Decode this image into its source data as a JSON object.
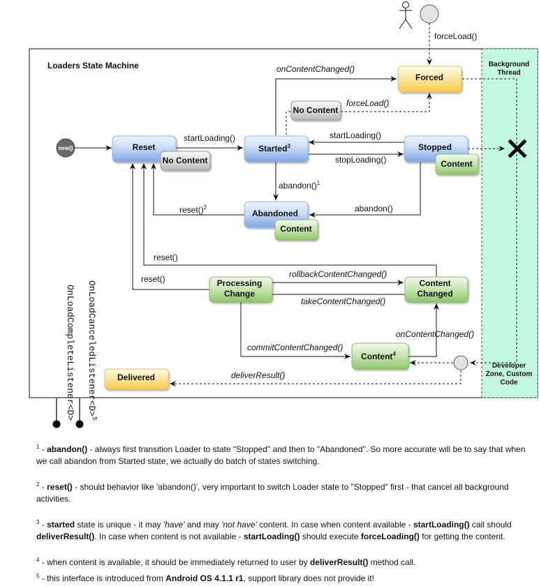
{
  "diagram": {
    "title": "Loaders State Machine",
    "zones": {
      "background_thread": "Background Thread",
      "background_thread_lines": [
        "Background",
        "Thread"
      ],
      "developer_zone_lines": [
        "Developer",
        "Zone, Custom",
        "Code"
      ]
    },
    "colors": {
      "blue_state": "#8fb4e8",
      "green_state": "#a9d48a",
      "yellow_state": "#fbd66a",
      "gray_state": "#cfcfcf",
      "zone_fill": "#c4f7e1"
    },
    "start_node": "new()",
    "states": {
      "reset": "Reset",
      "started": "Started",
      "started_sup": "3",
      "stopped": "Stopped",
      "abandoned": "Abandoned",
      "forced": "Forced",
      "processing_change_lines": [
        "Processing",
        "Change"
      ],
      "content_changed_lines": [
        "Content",
        "Changed"
      ],
      "content": "Content",
      "content_sup": "4",
      "delivered": "Delivered"
    },
    "badges": {
      "reset_badge": "No Content",
      "started_badge": "No Content",
      "stopped_badge": "Content",
      "abandoned_badge": "Content"
    },
    "transitions": {
      "force_load_user": "forceLoad()",
      "force_load": "forceLoad()",
      "on_content_changed_top": "onContentChanged()",
      "start_loading_1": "startLoading()",
      "start_loading_2": "startLoading()",
      "stop_loading": "stopLoading()",
      "abandon_1": "abandon()",
      "abandon_1_sup": "1",
      "abandon_2": "abandon()",
      "reset_2": "reset()",
      "reset_2_sup": "2",
      "reset_a": "reset()",
      "reset_b": "reset()",
      "rollback": "rollbackContentChanged()",
      "take": "takeContentChanged()",
      "commit": "commitContentChanged()",
      "on_content_changed_bottom": "onContentChanged()",
      "deliver_result": "deliverResult()"
    },
    "listeners": {
      "complete": "OnLoadCompleteListener<D>",
      "canceled": "OnLoadCanceledListener<D>",
      "canceled_sup": "5"
    }
  },
  "footnotes": [
    {
      "num": "1",
      "bold": "abandon()",
      "text": " - always first transition Loader to state  \"Stopped\" and then to \"Abandoned\". So more accurate will be to say that when we call abandon from Started state, we actually do batch of states switching."
    },
    {
      "num": "2",
      "bold": "reset()",
      "text": " - should behavior like 'abandon()', very important to switch Loader state to \"Stopped\" first - that cancel all background activities."
    },
    {
      "num": "3",
      "parts": [
        {
          "b": "started"
        },
        {
          "t": " state is unique - it may "
        },
        {
          "i": "'have'"
        },
        {
          "t": " and may "
        },
        {
          "i": "'not have'"
        },
        {
          "t": " content. In case when content available - "
        },
        {
          "b": "startLoading()"
        },
        {
          "t": " call should "
        },
        {
          "b": "deliverResult()"
        },
        {
          "t": ". In case when content is not available - "
        },
        {
          "b": "startLoading()"
        },
        {
          "t": " should execute "
        },
        {
          "b": "forceLoading()"
        },
        {
          "t": " for getting the content."
        }
      ]
    },
    {
      "num": "4",
      "parts": [
        {
          "t": "when content is available, it should be immediately returned to user by "
        },
        {
          "b": "deliverResult()"
        },
        {
          "t": " method call."
        }
      ]
    },
    {
      "num": "5",
      "parts": [
        {
          "t": "this interface is introduced from "
        },
        {
          "b": "Android OS 4.1.1 r1"
        },
        {
          "t": ", support library does not provide it!"
        }
      ]
    }
  ]
}
